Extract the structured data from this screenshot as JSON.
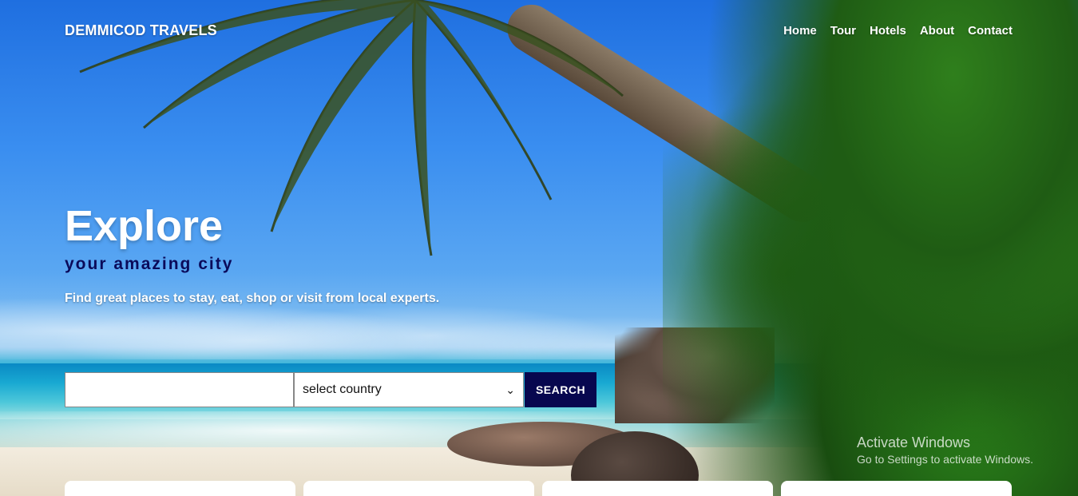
{
  "navbar": {
    "brand": "DEMMICOD TRAVELS",
    "links": [
      "Home",
      "Tour",
      "Hotels",
      "About",
      "Contact"
    ]
  },
  "hero": {
    "title": "Explore",
    "subtitle": "your amazing city",
    "tagline": "Find great places to stay, eat, shop or visit from local experts."
  },
  "search": {
    "input_value": "",
    "select_value": "select country",
    "button_label": "SEARCH"
  },
  "watermark": {
    "line1": "Activate Windows",
    "line2": "Go to Settings to activate Windows."
  },
  "colors": {
    "accent": "#07074f",
    "subtitle": "#0a0a5a"
  }
}
